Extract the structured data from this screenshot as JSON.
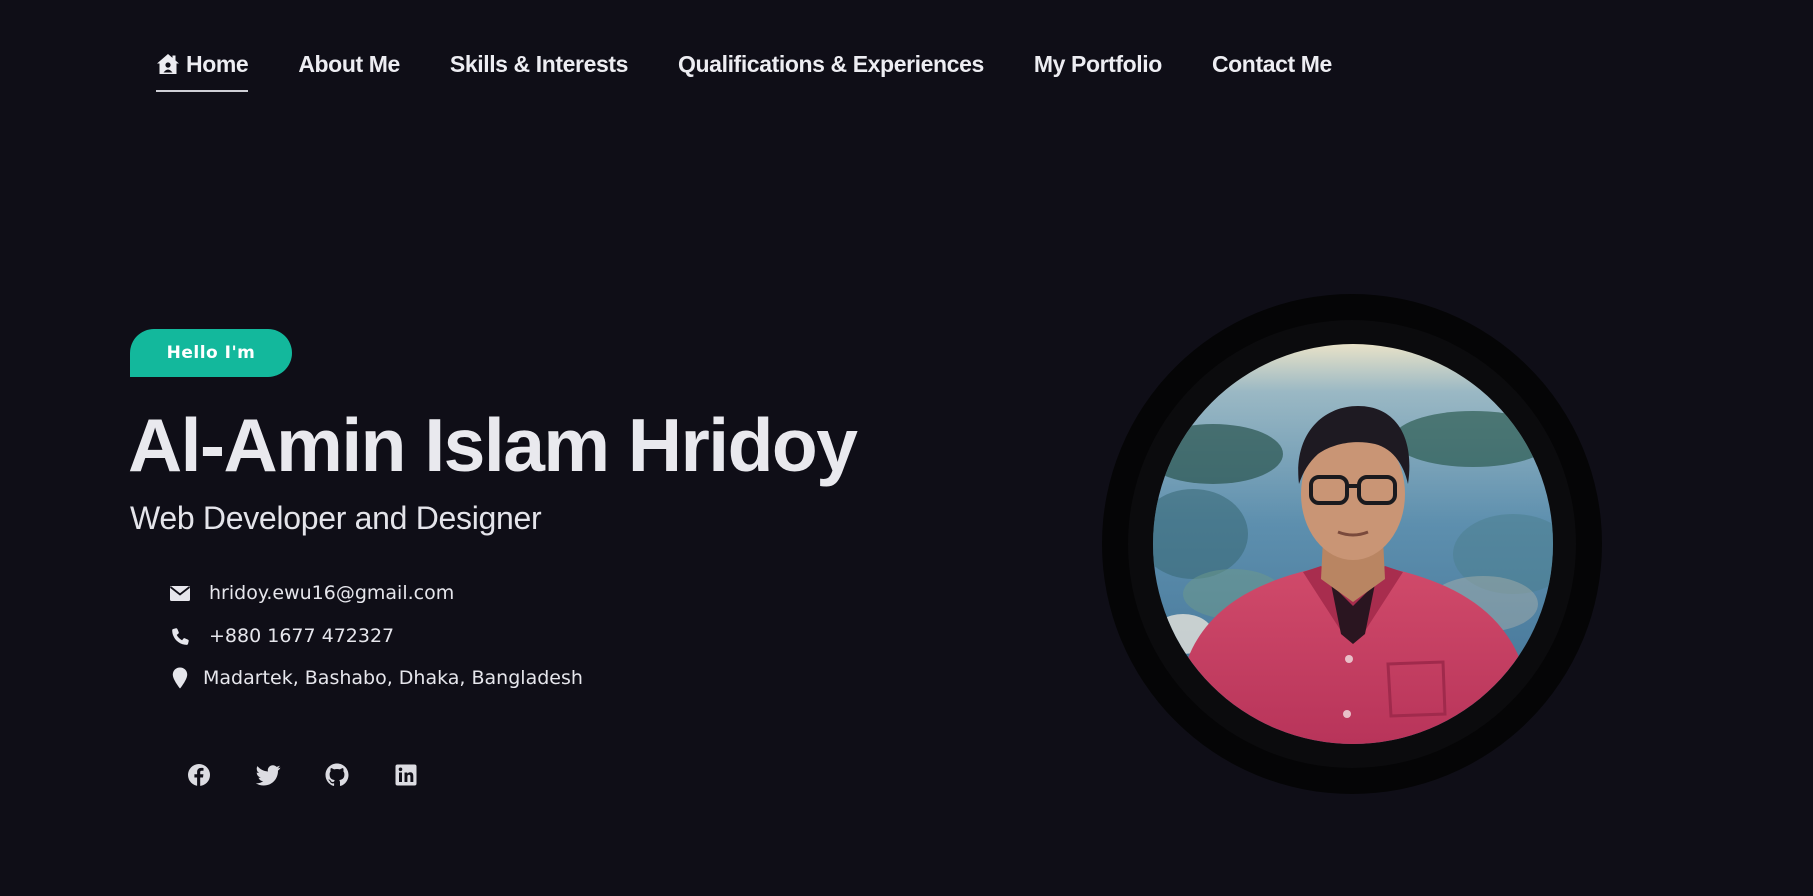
{
  "nav": {
    "items": [
      {
        "label": "Home",
        "icon": "home-icon",
        "active": true
      },
      {
        "label": "About Me"
      },
      {
        "label": "Skills & Interests"
      },
      {
        "label": "Qualifications & Experiences"
      },
      {
        "label": "My Portfolio"
      },
      {
        "label": "Contact Me"
      }
    ]
  },
  "hero": {
    "badge": "Hello I'm",
    "name": "Al-Amin Islam Hridoy",
    "role": "Web Developer and Designer",
    "contacts": {
      "email": {
        "icon": "envelope-icon",
        "text": "hridoy.ewu16@gmail.com"
      },
      "phone": {
        "icon": "phone-icon",
        "text": "+880 1677 472327"
      },
      "address": {
        "icon": "map-marker-icon",
        "text": "Madartek, Bashabo, Dhaka, Bangladesh"
      }
    },
    "socials": [
      "facebook-icon",
      "twitter-icon",
      "github-icon",
      "linkedin-icon"
    ]
  },
  "colors": {
    "background": "#0f0e17",
    "accent": "#13b89c",
    "text": "#ececf1"
  }
}
